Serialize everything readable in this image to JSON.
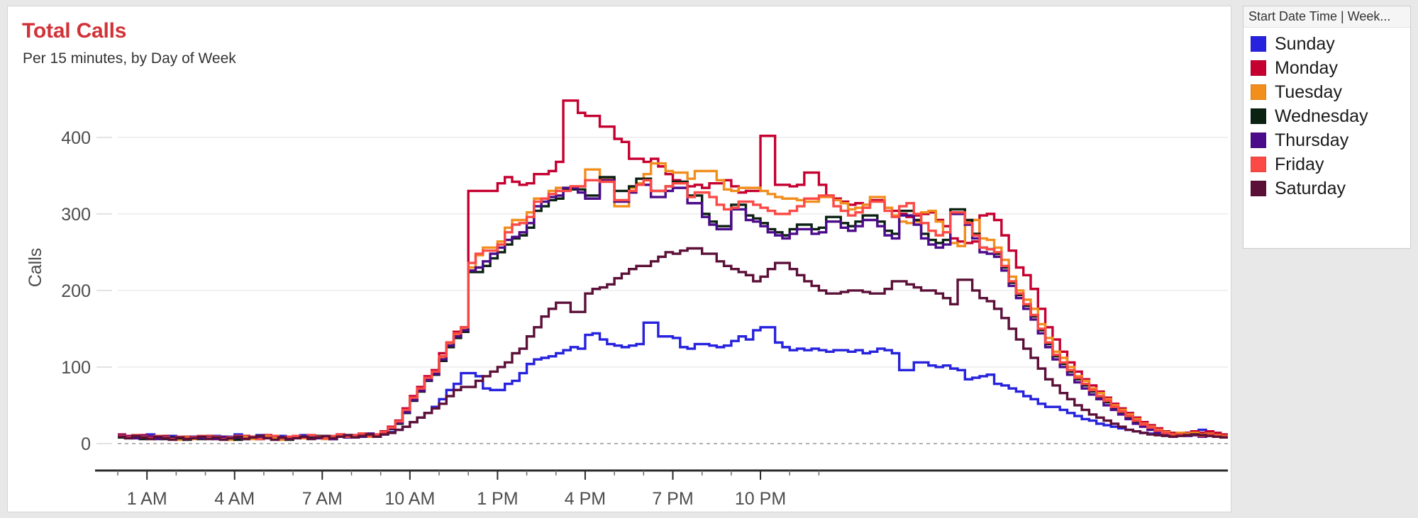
{
  "panel": {
    "title": "Total Calls",
    "subtitle": "Per 15 minutes, by Day of Week",
    "title_color": "#d13238"
  },
  "legend": {
    "header_title": "Start Date Time | Week...",
    "items": [
      {
        "label": "Sunday",
        "color": "#2622dd"
      },
      {
        "label": "Monday",
        "color": "#c50030"
      },
      {
        "label": "Tuesday",
        "color": "#f28e1c"
      },
      {
        "label": "Wednesday",
        "color": "#0b2112"
      },
      {
        "label": "Thursday",
        "color": "#4b0b8a"
      },
      {
        "label": "Friday",
        "color": "#fb4a46"
      },
      {
        "label": "Saturday",
        "color": "#5c1038"
      }
    ]
  },
  "chart_data": {
    "type": "line",
    "line_style": "step",
    "title": "Total Calls",
    "subtitle": "Per 15 minutes, by Day of Week",
    "xlabel": "",
    "ylabel": "Calls",
    "ylim": [
      0,
      460
    ],
    "yticks": [
      0,
      100,
      200,
      300,
      400
    ],
    "grid": true,
    "legend_position": "right",
    "x_interval_minutes": 15,
    "x_start_hour": 0,
    "xtick_labels": [
      "1 AM",
      "4 AM",
      "7 AM",
      "10 AM",
      "1 PM",
      "4 PM",
      "7 PM",
      "10 PM"
    ],
    "xtick_hours": [
      1,
      4,
      7,
      10,
      13,
      16,
      19,
      22
    ],
    "x_minor_tick_step_hours": 1,
    "series": [
      {
        "name": "Sunday",
        "color": "#2622dd",
        "values": [
          10,
          9,
          11,
          8,
          12,
          9,
          7,
          10,
          8,
          6,
          9,
          7,
          8,
          10,
          7,
          9,
          12,
          10,
          8,
          11,
          9,
          7,
          10,
          8,
          9,
          11,
          8,
          10,
          7,
          9,
          12,
          10,
          9,
          11,
          13,
          10,
          12,
          15,
          18,
          22,
          28,
          34,
          40,
          48,
          58,
          70,
          78,
          92,
          92,
          88,
          72,
          70,
          70,
          78,
          82,
          92,
          104,
          110,
          112,
          114,
          118,
          122,
          126,
          124,
          142,
          144,
          136,
          130,
          128,
          126,
          128,
          130,
          158,
          158,
          140,
          140,
          138,
          126,
          124,
          130,
          130,
          128,
          126,
          128,
          134,
          140,
          136,
          148,
          152,
          152,
          132,
          126,
          122,
          124,
          122,
          124,
          122,
          120,
          122,
          122,
          120,
          122,
          118,
          120,
          124,
          122,
          118,
          96,
          96,
          106,
          106,
          102,
          100,
          102,
          98,
          96,
          84,
          86,
          88,
          90,
          78,
          76,
          72,
          68,
          62,
          58,
          52,
          48,
          48,
          44,
          40,
          36,
          32,
          30,
          26,
          24,
          22,
          20,
          18,
          16,
          14,
          13,
          12,
          11,
          10,
          12,
          14,
          16,
          18,
          14,
          12,
          10
        ]
      },
      {
        "name": "Monday",
        "color": "#c50030",
        "values": [
          12,
          10,
          8,
          11,
          9,
          7,
          10,
          8,
          6,
          9,
          7,
          8,
          10,
          7,
          9,
          6,
          8,
          10,
          7,
          9,
          11,
          8,
          6,
          9,
          10,
          8,
          11,
          9,
          7,
          10,
          12,
          9,
          11,
          13,
          10,
          12,
          16,
          22,
          30,
          46,
          62,
          74,
          88,
          96,
          118,
          132,
          146,
          152,
          330,
          330,
          330,
          330,
          340,
          348,
          342,
          338,
          340,
          352,
          352,
          356,
          368,
          448,
          448,
          432,
          428,
          428,
          414,
          414,
          398,
          394,
          372,
          372,
          368,
          372,
          362,
          352,
          344,
          342,
          336,
          338,
          334,
          340,
          340,
          344,
          336,
          328,
          330,
          330,
          402,
          402,
          338,
          338,
          336,
          338,
          354,
          354,
          338,
          324,
          320,
          316,
          312,
          314,
          312,
          318,
          318,
          308,
          304,
          300,
          296,
          298,
          300,
          302,
          292,
          284,
          268,
          264,
          262,
          264,
          298,
          300,
          292,
          272,
          252,
          230,
          220,
          202,
          176,
          152,
          136,
          120,
          106,
          94,
          84,
          76,
          68,
          60,
          52,
          46,
          40,
          34,
          28,
          24,
          20,
          16,
          14,
          12,
          14,
          16,
          14,
          16,
          14,
          12
        ]
      },
      {
        "name": "Tuesday",
        "color": "#f28e1c",
        "values": [
          9,
          8,
          7,
          10,
          6,
          8,
          9,
          7,
          5,
          8,
          6,
          7,
          9,
          6,
          8,
          5,
          7,
          9,
          6,
          8,
          10,
          7,
          5,
          8,
          9,
          7,
          10,
          8,
          6,
          9,
          11,
          8,
          10,
          12,
          9,
          11,
          15,
          20,
          28,
          42,
          58,
          70,
          84,
          92,
          112,
          130,
          142,
          150,
          230,
          246,
          256,
          256,
          264,
          282,
          292,
          292,
          302,
          320,
          320,
          330,
          334,
          334,
          336,
          336,
          358,
          358,
          346,
          346,
          310,
          310,
          334,
          340,
          352,
          366,
          366,
          356,
          354,
          354,
          346,
          356,
          356,
          356,
          344,
          332,
          330,
          334,
          334,
          334,
          330,
          326,
          322,
          320,
          320,
          318,
          316,
          316,
          322,
          322,
          318,
          314,
          306,
          308,
          312,
          322,
          322,
          308,
          298,
          290,
          288,
          290,
          302,
          304,
          290,
          276,
          262,
          258,
          290,
          292,
          268,
          266,
          256,
          240,
          218,
          200,
          188,
          176,
          156,
          138,
          120,
          112,
          100,
          88,
          82,
          72,
          66,
          58,
          50,
          44,
          38,
          32,
          26,
          22,
          18,
          15,
          12,
          14,
          13,
          14,
          12,
          13,
          11,
          10
        ]
      },
      {
        "name": "Wednesday",
        "color": "#0b2112",
        "values": [
          8,
          7,
          9,
          6,
          8,
          10,
          6,
          8,
          7,
          5,
          8,
          6,
          7,
          9,
          6,
          8,
          5,
          7,
          9,
          6,
          8,
          10,
          7,
          5,
          8,
          9,
          7,
          10,
          8,
          6,
          9,
          11,
          8,
          10,
          12,
          9,
          14,
          19,
          26,
          40,
          56,
          68,
          82,
          90,
          108,
          126,
          138,
          146,
          224,
          224,
          232,
          242,
          250,
          260,
          268,
          272,
          282,
          304,
          310,
          318,
          320,
          332,
          332,
          332,
          324,
          324,
          348,
          348,
          330,
          330,
          336,
          346,
          346,
          330,
          330,
          336,
          342,
          342,
          324,
          324,
          300,
          290,
          284,
          284,
          312,
          312,
          298,
          294,
          288,
          280,
          276,
          272,
          280,
          286,
          286,
          280,
          282,
          296,
          296,
          288,
          284,
          290,
          298,
          298,
          290,
          278,
          274,
          304,
          304,
          292,
          274,
          266,
          262,
          266,
          306,
          306,
          292,
          274,
          256,
          254,
          248,
          230,
          210,
          194,
          180,
          166,
          148,
          130,
          114,
          104,
          94,
          84,
          76,
          68,
          60,
          54,
          46,
          40,
          34,
          28,
          24,
          20,
          16,
          14,
          11,
          12,
          11,
          12,
          10,
          12,
          10,
          9
        ]
      },
      {
        "name": "Thursday",
        "color": "#4b0b8a",
        "values": [
          11,
          9,
          7,
          10,
          8,
          6,
          9,
          7,
          8,
          6,
          9,
          7,
          8,
          6,
          9,
          7,
          8,
          6,
          9,
          7,
          8,
          10,
          7,
          6,
          9,
          8,
          10,
          7,
          9,
          6,
          10,
          8,
          11,
          9,
          13,
          10,
          14,
          20,
          27,
          41,
          57,
          69,
          83,
          91,
          110,
          128,
          140,
          148,
          226,
          230,
          238,
          248,
          256,
          266,
          270,
          276,
          288,
          310,
          316,
          322,
          324,
          334,
          334,
          328,
          320,
          320,
          344,
          344,
          316,
          316,
          328,
          338,
          338,
          322,
          322,
          330,
          334,
          334,
          314,
          314,
          296,
          286,
          280,
          280,
          306,
          306,
          292,
          290,
          284,
          276,
          272,
          268,
          274,
          280,
          280,
          274,
          276,
          290,
          290,
          282,
          278,
          284,
          292,
          292,
          284,
          272,
          268,
          298,
          298,
          286,
          268,
          260,
          256,
          260,
          300,
          300,
          286,
          268,
          250,
          248,
          244,
          226,
          206,
          190,
          176,
          162,
          144,
          126,
          110,
          100,
          90,
          80,
          72,
          64,
          58,
          50,
          44,
          38,
          32,
          26,
          22,
          18,
          15,
          13,
          10,
          11,
          10,
          11,
          9,
          11,
          9,
          8
        ]
      },
      {
        "name": "Friday",
        "color": "#fb4a46",
        "values": [
          10,
          8,
          11,
          9,
          7,
          10,
          8,
          6,
          9,
          7,
          8,
          10,
          7,
          9,
          6,
          8,
          10,
          7,
          9,
          6,
          8,
          10,
          7,
          9,
          10,
          8,
          11,
          9,
          7,
          10,
          12,
          9,
          11,
          13,
          10,
          12,
          15,
          21,
          29,
          44,
          60,
          72,
          86,
          94,
          114,
          132,
          144,
          152,
          236,
          248,
          252,
          252,
          260,
          276,
          286,
          288,
          296,
          316,
          320,
          326,
          330,
          330,
          336,
          336,
          344,
          344,
          342,
          342,
          318,
          318,
          330,
          338,
          344,
          330,
          330,
          336,
          340,
          340,
          322,
          328,
          328,
          322,
          312,
          306,
          308,
          316,
          316,
          312,
          308,
          304,
          300,
          300,
          304,
          310,
          320,
          320,
          324,
          324,
          310,
          304,
          298,
          302,
          308,
          316,
          316,
          304,
          296,
          310,
          314,
          300,
          288,
          278,
          272,
          276,
          302,
          302,
          288,
          272,
          256,
          254,
          250,
          232,
          212,
          196,
          182,
          168,
          150,
          132,
          116,
          106,
          96,
          86,
          78,
          70,
          62,
          56,
          48,
          42,
          36,
          30,
          25,
          21,
          17,
          14,
          11,
          12,
          11,
          12,
          10,
          12,
          10,
          9
        ]
      },
      {
        "name": "Saturday",
        "color": "#5c1038",
        "values": [
          9,
          7,
          10,
          8,
          6,
          9,
          7,
          5,
          8,
          6,
          7,
          9,
          6,
          8,
          5,
          7,
          9,
          6,
          8,
          10,
          7,
          5,
          8,
          6,
          7,
          9,
          6,
          8,
          10,
          7,
          9,
          11,
          8,
          10,
          12,
          9,
          12,
          14,
          18,
          22,
          28,
          34,
          40,
          46,
          52,
          62,
          70,
          74,
          74,
          82,
          88,
          94,
          100,
          106,
          118,
          124,
          140,
          152,
          166,
          176,
          184,
          184,
          172,
          172,
          196,
          202,
          204,
          208,
          216,
          222,
          228,
          232,
          232,
          238,
          244,
          250,
          248,
          252,
          255,
          255,
          248,
          248,
          238,
          232,
          228,
          224,
          220,
          212,
          218,
          228,
          236,
          236,
          228,
          220,
          212,
          206,
          200,
          196,
          196,
          198,
          200,
          200,
          198,
          196,
          196,
          202,
          212,
          212,
          208,
          204,
          200,
          200,
          196,
          190,
          182,
          214,
          214,
          200,
          190,
          186,
          176,
          164,
          150,
          136,
          124,
          112,
          98,
          84,
          76,
          66,
          58,
          50,
          44,
          38,
          34,
          30,
          26,
          22,
          18,
          16,
          14,
          12,
          11,
          10,
          9,
          10,
          11,
          12,
          11,
          10,
          9,
          8
        ]
      }
    ]
  }
}
